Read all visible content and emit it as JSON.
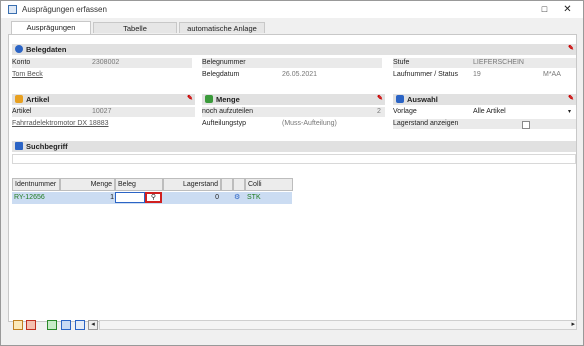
{
  "window": {
    "title": "Ausprägungen erfassen",
    "maximize_glyph": "□",
    "close_glyph": "✕"
  },
  "tabs": [
    {
      "label": "Ausprägungen"
    },
    {
      "label": "Tabelle"
    },
    {
      "label": "automatische Anlage"
    }
  ],
  "belegdaten": {
    "title": "Belegdaten",
    "konto_label": "Konto",
    "konto_value": "2308002",
    "kunde": "Tom Beck",
    "belegnummer_label": "Belegnummer",
    "belegnummer_value": "",
    "belegdatum_label": "Belegdatum",
    "belegdatum_value": "26.05.2021",
    "stufe_label": "Stufe",
    "stufe_value": "LIEFERSCHEIN",
    "laufnummer_label": "Laufnummer / Status",
    "laufnummer_value": "19",
    "status_value": "M*AA"
  },
  "artikel": {
    "title": "Artikel",
    "artikel_label": "Artikel",
    "artikel_value": "10027",
    "bezeichnung": "Fahrradelektromotor DX 18883"
  },
  "menge": {
    "title": "Menge",
    "aufzuteilen_label": "noch aufzuteilen",
    "aufzuteilen_value": "2",
    "aufteilungstyp_label": "Aufteilungstyp",
    "aufteilungstyp_value": "(Muss-Aufteilung)"
  },
  "auswahl": {
    "title": "Auswahl",
    "vorlage_label": "Vorlage",
    "vorlage_value": "Alle Artikel",
    "lagerstand_label": "Lagerstand anzeigen"
  },
  "suchbegriff": {
    "title": "Suchbegriff"
  },
  "grid": {
    "headers": [
      "Identnummer",
      "Menge",
      "Beleg",
      "Lagerstand",
      "Colli"
    ],
    "row": {
      "identnummer": "RY-12656",
      "menge": "1",
      "beleg": "",
      "lagerstand": "0",
      "colli": "STK"
    }
  },
  "colors": {
    "accent": "#2b64c5",
    "selection": "#cbdcf2",
    "highlight_border": "#d02020",
    "green_text": "#1e7a1e"
  }
}
